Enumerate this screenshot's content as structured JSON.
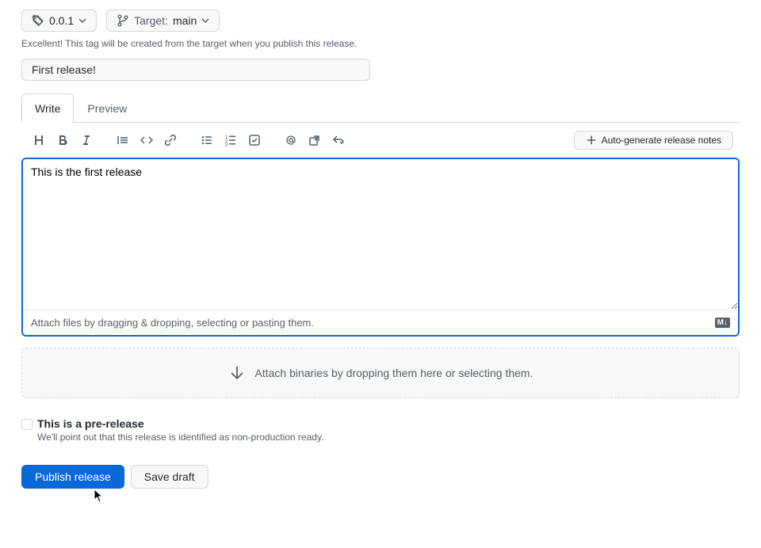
{
  "tag": {
    "version": "0.0.1",
    "targetLabel": "Target:",
    "targetValue": "main"
  },
  "tagHint": "Excellent! This tag will be created from the target when you publish this release.",
  "titleInput": {
    "value": "First release!"
  },
  "tabs": {
    "write": "Write",
    "preview": "Preview"
  },
  "toolbar": {
    "autoGenerate": "Auto-generate release notes"
  },
  "description": {
    "value": "This is the first release"
  },
  "attachHint": "Attach files by dragging & dropping, selecting or pasting them.",
  "mdBadge": "M↓",
  "dropzone": "Attach binaries by dropping them here or selecting them.",
  "prerelease": {
    "title": "This is a pre-release",
    "hint": "We'll point out that this release is identified as non-production ready."
  },
  "actions": {
    "publish": "Publish release",
    "draft": "Save draft"
  }
}
